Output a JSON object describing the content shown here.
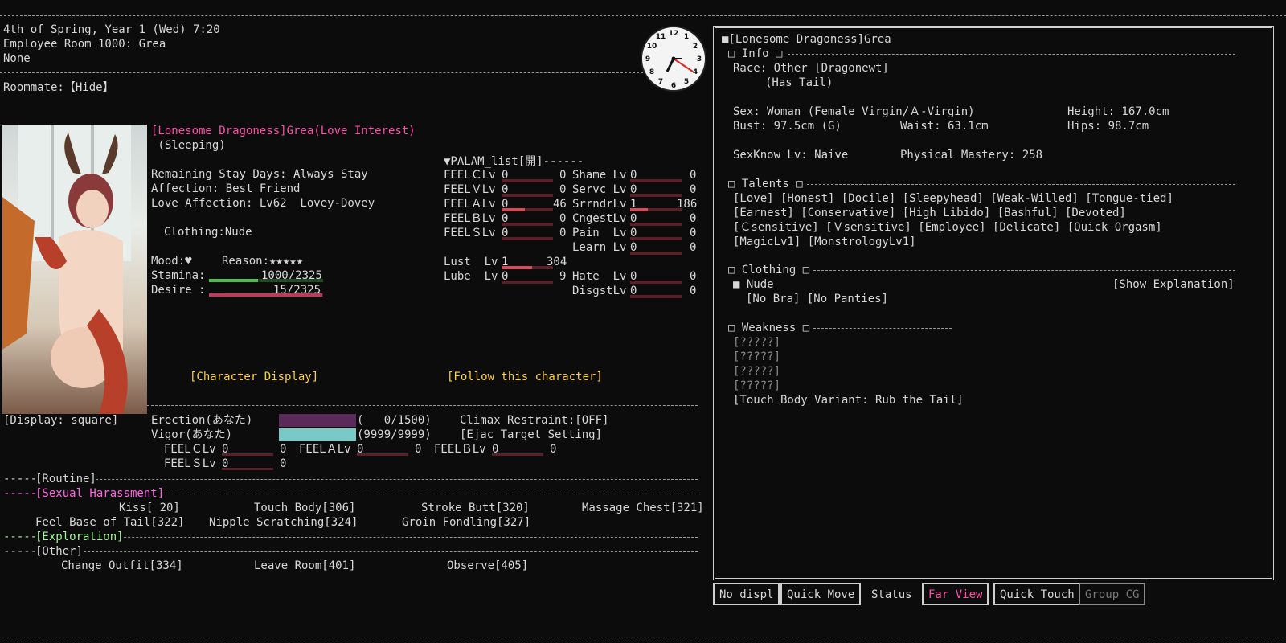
{
  "header": {
    "date": "4th of Spring, Year 1 (Wed) 7:20",
    "location": "Employee Room 1000: Grea",
    "status": "None"
  },
  "roommate": "Roommate:【Hide】",
  "character": {
    "name": "[Lonesome Dragoness]Grea(Love Interest)",
    "state": " (Sleeping)",
    "stay": "Remaining Stay Days: Always Stay",
    "affection": "Affection: Best Friend",
    "love_affection": "Love Affection: Lv62  Lovey-Dovey",
    "clothing": "Clothing:Nude",
    "mood_label": "Mood:♥",
    "reason_label": "Reason:★★★★★",
    "stamina_label": "Stamina:",
    "stamina_value": "1000/2325",
    "stamina_fraction": 0.43,
    "desire_label": "Desire :",
    "desire_value": "15/2325",
    "desire_fraction": 0.99
  },
  "palam": {
    "header": "▼PALAM_list[開]------",
    "left": [
      {
        "label": "FEELＣLv",
        "lv": "0",
        "val": "0",
        "fill": 0
      },
      {
        "label": "FEELＶLv",
        "lv": "0",
        "val": "0",
        "fill": 0
      },
      {
        "label": "FEELＡLv",
        "lv": "0",
        "val": "46",
        "fill": 0.45
      },
      {
        "label": "FEELＢLv",
        "lv": "0",
        "val": "0",
        "fill": 0
      },
      {
        "label": "FEELＳLv",
        "lv": "0",
        "val": "0",
        "fill": 0
      }
    ],
    "right": [
      {
        "label": "Shame Lv",
        "lv": "0",
        "val": "0",
        "fill": 0
      },
      {
        "label": "Servc Lv",
        "lv": "0",
        "val": "0",
        "fill": 0
      },
      {
        "label": "SrrndrLv",
        "lv": "1",
        "val": "186",
        "fill": 0.35
      },
      {
        "label": "CngestLv",
        "lv": "0",
        "val": "0",
        "fill": 0
      },
      {
        "label": "Pain  Lv",
        "lv": "0",
        "val": "0",
        "fill": 0
      },
      {
        "label": "Learn Lv",
        "lv": "0",
        "val": "0",
        "fill": 0
      }
    ],
    "lust": {
      "label": "Lust  Lv",
      "lv": "1",
      "val": "304",
      "fill": 0.6
    },
    "lube": {
      "label": "Lube  Lv",
      "lv": "0",
      "val": "9",
      "fill": 0
    },
    "hate": {
      "label": "Hate  Lv",
      "lv": "0",
      "val": "0",
      "fill": 0
    },
    "disgust": {
      "label": "DisgstLv",
      "lv": "0",
      "val": "0",
      "fill": 0
    }
  },
  "buttons": {
    "char_display": "[Character Display]",
    "follow": "[Follow this character]",
    "display_square": "[Display: square]"
  },
  "player": {
    "erection_label": "Erection(あなた)",
    "erection_value": "(   0/1500)",
    "erection_fraction": 1.0,
    "vigor_label": "Vigor(あなた)",
    "vigor_value": "(9999/9999)",
    "vigor_fraction": 1.0,
    "climax": "Climax Restraint:[OFF]",
    "ejac": "[Ejac Target Setting]",
    "feels": [
      {
        "label": "FEELＣLv",
        "lv": "0",
        "val": "0"
      },
      {
        "label": "FEELＡLv",
        "lv": "0",
        "val": "0"
      },
      {
        "label": "FEELＢLv",
        "lv": "0",
        "val": "0"
      },
      {
        "label": "FEELＳLv",
        "lv": "0",
        "val": "0"
      }
    ]
  },
  "commands": {
    "routine": "[Routine]",
    "harassment": "[Sexual Harassment]",
    "harassment_items": [
      "Kiss[ 20]",
      "Touch Body[306]",
      "Stroke Butt[320]",
      "Massage Chest[321]",
      "Feel Base of Tail[322]",
      "Nipple Scratching[324]",
      "Groin Fondling[327]"
    ],
    "exploration": "[Exploration]",
    "other": "[Other]",
    "other_items": [
      "Change Outfit[334]",
      "Leave Room[401]",
      "Observe[405]"
    ]
  },
  "panel": {
    "title": "■[Lonesome Dragoness]Grea",
    "info_header": "□ Info □",
    "race": "Race: Other [Dragonewt]",
    "tail": "(Has Tail)",
    "sex": "Sex: Woman (Female Virgin/Ａ-Virgin)",
    "height": "Height: 167.0cm",
    "bust": "Bust: 97.5cm (G)",
    "waist": "Waist: 63.1cm",
    "hips": "Hips: 98.7cm",
    "sexknow": "SexKnow Lv: Naive",
    "physical": "Physical Mastery: 258",
    "talents_header": "□ Talents □",
    "talents": [
      "[Love] [Honest] [Docile] [Sleepyhead] [Weak-Willed] [Tongue-tied]",
      "[Earnest] [Conservative] [High Libido] [Bashful] [Devoted]",
      "[Ｃsensitive] [Ｖsensitive] [Employee] [Delicate] [Quick Orgasm]",
      "[MagicLv1] [MonstrologyLv1]"
    ],
    "clothing_header": "□ Clothing □",
    "nude": "■ Nude",
    "show_expl": "[Show Explanation]",
    "underwear": "[No Bra] [No Panties]",
    "weakness_header": "□ Weakness □",
    "weakness": [
      "[?????]",
      "[?????]",
      "[?????]",
      "[?????]"
    ],
    "touch_variant": "[Touch Body Variant: Rub the Tail]"
  },
  "tabs": [
    "No displ",
    "Quick Move",
    "Status",
    "Far View",
    "Quick Touch",
    "Group CG"
  ]
}
